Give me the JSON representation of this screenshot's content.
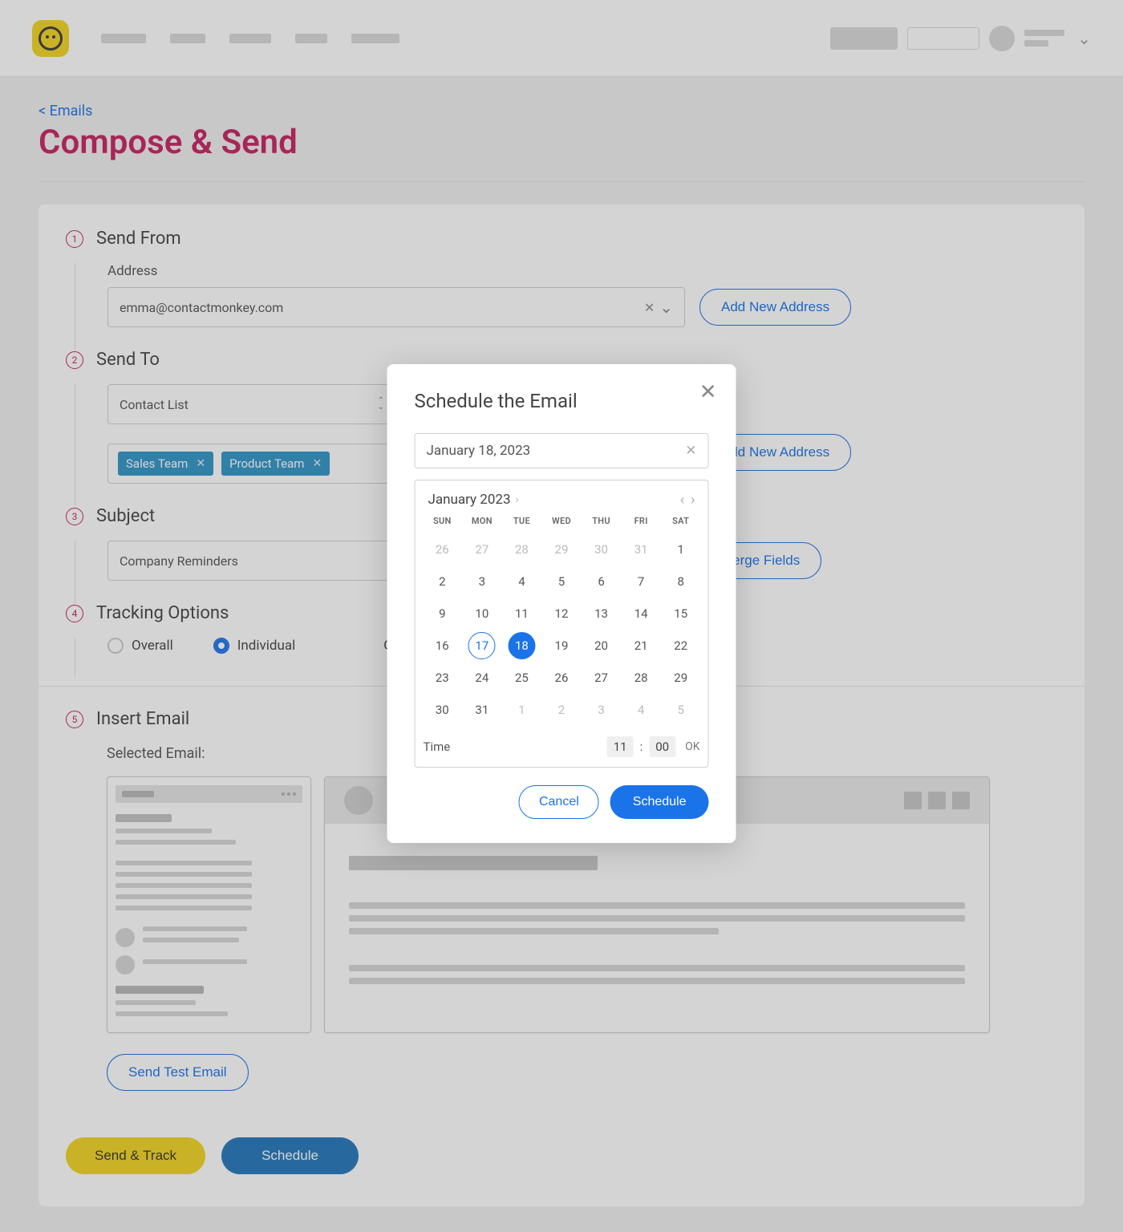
{
  "nav": {
    "back_link": "< Emails"
  },
  "page": {
    "title": "Compose & Send"
  },
  "steps": {
    "send_from": {
      "num": "1",
      "title": "Send From",
      "address_label": "Address",
      "address_value": "emma@contactmonkey.com",
      "add_button": "Add New Address"
    },
    "send_to": {
      "num": "2",
      "title": "Send To",
      "list_type": "Contact List",
      "add_button": "Add New Address",
      "chips": [
        "Sales Team",
        "Product Team"
      ]
    },
    "subject": {
      "num": "3",
      "title": "Subject",
      "value": "Company Reminders",
      "merge_button": "Merge Fields"
    },
    "tracking": {
      "num": "4",
      "title": "Tracking Options",
      "options": {
        "overall": "Overall",
        "individual": "Individual",
        "selected": "individual"
      },
      "open_label": "Ope"
    },
    "insert": {
      "num": "5",
      "title": "Insert Email",
      "selected_label": "Selected Email:"
    }
  },
  "footer": {
    "send_test": "Send Test Email",
    "send_track": "Send & Track",
    "schedule": "Schedule"
  },
  "modal": {
    "title": "Schedule the Email",
    "date_value": "January 18, 2023",
    "month_label": "January 2023",
    "dow": [
      "SUN",
      "MON",
      "TUE",
      "WED",
      "THU",
      "FRI",
      "SAT"
    ],
    "weeks": [
      [
        {
          "d": "26",
          "m": true
        },
        {
          "d": "27",
          "m": true
        },
        {
          "d": "28",
          "m": true
        },
        {
          "d": "29",
          "m": true
        },
        {
          "d": "30",
          "m": true
        },
        {
          "d": "31",
          "m": true
        },
        {
          "d": "1"
        }
      ],
      [
        {
          "d": "2"
        },
        {
          "d": "3"
        },
        {
          "d": "4"
        },
        {
          "d": "5"
        },
        {
          "d": "6"
        },
        {
          "d": "7"
        },
        {
          "d": "8"
        }
      ],
      [
        {
          "d": "9"
        },
        {
          "d": "10"
        },
        {
          "d": "11"
        },
        {
          "d": "12"
        },
        {
          "d": "13"
        },
        {
          "d": "14"
        },
        {
          "d": "15"
        }
      ],
      [
        {
          "d": "16"
        },
        {
          "d": "17",
          "today": true
        },
        {
          "d": "18",
          "sel": true
        },
        {
          "d": "19"
        },
        {
          "d": "20"
        },
        {
          "d": "21"
        },
        {
          "d": "22"
        }
      ],
      [
        {
          "d": "23"
        },
        {
          "d": "24"
        },
        {
          "d": "25"
        },
        {
          "d": "26"
        },
        {
          "d": "27"
        },
        {
          "d": "28"
        },
        {
          "d": "29"
        }
      ],
      [
        {
          "d": "30"
        },
        {
          "d": "31"
        },
        {
          "d": "1",
          "m": true
        },
        {
          "d": "2",
          "m": true
        },
        {
          "d": "3",
          "m": true
        },
        {
          "d": "4",
          "m": true
        },
        {
          "d": "5",
          "m": true
        }
      ]
    ],
    "time_label": "Time",
    "time_h": "11",
    "time_m": "00",
    "time_ok": "OK",
    "cancel": "Cancel",
    "schedule": "Schedule"
  }
}
